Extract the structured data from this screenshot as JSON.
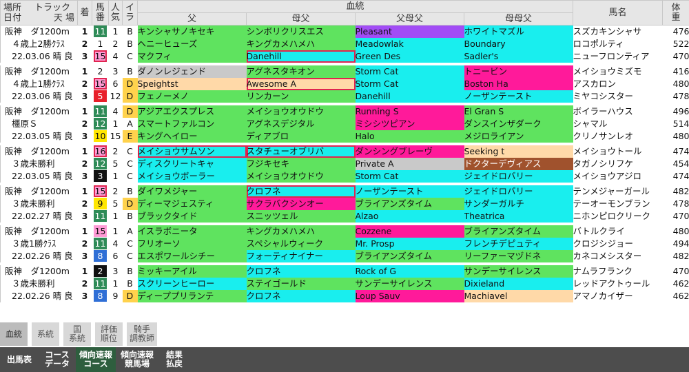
{
  "colors": {
    "green": "#5fe35f",
    "cyan": "#19eeee",
    "purple": "#a24df5",
    "pink": "#ff1a9a",
    "peach": "#ffd9a8",
    "gray": "#c9c9c9",
    "brown": "#a0522d",
    "highlight": "#e0244f"
  },
  "header": {
    "place": "場所",
    "date": "日付",
    "track": "トラック",
    "weather_field": "天 場",
    "finish": "着",
    "umaban_top": "馬",
    "umaban_bottom": "番",
    "pop_top": "人",
    "pop_bottom": "気",
    "ira_top": "イ",
    "ira_bottom": "ラ",
    "pedigree": "血統",
    "sire": "父",
    "dam_sire": "母父",
    "sire_sire": "父母父",
    "dam_dam_sire": "母母父",
    "horse_name": "馬名",
    "weight_top": "体",
    "weight_bottom": "重"
  },
  "races": [
    {
      "line1": "阪神　ダ1200m",
      "line2": "４歳上2勝ｸﾗｽ",
      "line3": "22.03.06 晴 良",
      "rows": [
        {
          "finish": "1",
          "umaban": "11",
          "umaban_bg": "#2e8b57",
          "umaban_fg": "#ffffff",
          "umaban_hl": false,
          "pop": "1",
          "ira": "B",
          "ira_bg": "",
          "p1": "キンシャサノキセキ",
          "p1c": "green",
          "p1hl": false,
          "p2": "シンボリクリスエス",
          "p2c": "green",
          "p2hl": false,
          "p3": "Pleasant",
          "p3c": "purple",
          "p3hl": false,
          "p4": "ホワイトマズル",
          "p4c": "cyan",
          "p4hl": false,
          "name": "スズカキンシャサ",
          "weight": "476"
        },
        {
          "finish": "2",
          "umaban": "1",
          "umaban_bg": "#ffffff",
          "umaban_fg": "#111111",
          "umaban_hl": false,
          "pop": "2",
          "ira": "B",
          "ira_bg": "",
          "p1": "ヘニーヒューズ",
          "p1c": "green",
          "p1hl": false,
          "p2": "キングカメハメハ",
          "p2c": "green",
          "p2hl": false,
          "p3": "Meadowlak",
          "p3c": "cyan",
          "p3hl": false,
          "p4": "Boundary",
          "p4c": "cyan",
          "p4hl": false,
          "name": "ロコポルティ",
          "weight": "522"
        },
        {
          "finish": "3",
          "umaban": "15",
          "umaban_bg": "#ff9ad5",
          "umaban_fg": "#111111",
          "umaban_hl": true,
          "pop": "4",
          "ira": "C",
          "ira_bg": "",
          "p1": "マクフィ",
          "p1c": "green",
          "p1hl": false,
          "p2": "Danehill",
          "p2c": "cyan",
          "p2hl": true,
          "p3": "Green Des",
          "p3c": "cyan",
          "p3hl": false,
          "p4": "Sadler's",
          "p4c": "cyan",
          "p4hl": false,
          "name": "ニューフロンティア",
          "weight": "470"
        }
      ]
    },
    {
      "line1": "阪神　ダ1200m",
      "line2": "４歳上1勝ｸﾗｽ",
      "line3": "22.03.06 晴 良",
      "rows": [
        {
          "finish": "1",
          "umaban": "2",
          "umaban_bg": "#ffffff",
          "umaban_fg": "#111111",
          "umaban_hl": false,
          "pop": "3",
          "ira": "B",
          "ira_bg": "",
          "p1": "ダノンレジェンド",
          "p1c": "gray",
          "p1hl": false,
          "p2": "アグネスタキオン",
          "p2c": "green",
          "p2hl": false,
          "p3": "Storm Cat",
          "p3c": "cyan",
          "p3hl": false,
          "p4": "トニービン",
          "p4c": "pink",
          "p4hl": false,
          "name": "メイショウミズモ",
          "weight": "416"
        },
        {
          "finish": "2",
          "umaban": "15",
          "umaban_bg": "#ff9ad5",
          "umaban_fg": "#111111",
          "umaban_hl": true,
          "pop": "6",
          "ira": "D",
          "ira_bg": "#ffd24d",
          "p1": "Speightst",
          "p1c": "peach",
          "p1hl": false,
          "p2": "Awesome A",
          "p2c": "peach",
          "p2hl": true,
          "p3": "Storm Cat",
          "p3c": "cyan",
          "p3hl": false,
          "p4": "Boston Ha",
          "p4c": "pink",
          "p4hl": false,
          "name": "アスカロン",
          "weight": "480"
        },
        {
          "finish": "3",
          "umaban": "5",
          "umaban_bg": "#e8202a",
          "umaban_fg": "#ffffff",
          "umaban_hl": false,
          "pop": "12",
          "ira": "D",
          "ira_bg": "#ffd24d",
          "p1": "フェノーメノ",
          "p1c": "green",
          "p1hl": false,
          "p2": "リンカーン",
          "p2c": "green",
          "p2hl": false,
          "p3": "Danehill",
          "p3c": "cyan",
          "p3hl": false,
          "p4": "ノーザンテースト",
          "p4c": "cyan",
          "p4hl": false,
          "name": "ミヤコシスター",
          "weight": "478"
        }
      ]
    },
    {
      "line1": "阪神　ダ1200m",
      "line2": "橿原Ｓ",
      "line3": "22.03.05 晴 良",
      "rows": [
        {
          "finish": "1",
          "umaban": "11",
          "umaban_bg": "#2e8b57",
          "umaban_fg": "#ffffff",
          "umaban_hl": false,
          "pop": "4",
          "ira": "D",
          "ira_bg": "#ffd24d",
          "p1": "アジアエクスプレス",
          "p1c": "green",
          "p1hl": false,
          "p2": "メイショウオウドウ",
          "p2c": "green",
          "p2hl": false,
          "p3": "Running S",
          "p3c": "pink",
          "p3hl": false,
          "p4": "El Gran S",
          "p4c": "green",
          "p4hl": false,
          "name": "ボイラーハウス",
          "weight": "496"
        },
        {
          "finish": "2",
          "umaban": "12",
          "umaban_bg": "#2e8b57",
          "umaban_fg": "#ffffff",
          "umaban_hl": false,
          "pop": "1",
          "ira": "A",
          "ira_bg": "",
          "p1": "スマートファルコン",
          "p1c": "green",
          "p1hl": false,
          "p2": "アグネスデジタル",
          "p2c": "green",
          "p2hl": false,
          "p3": "ミシシツピアン",
          "p3c": "pink",
          "p3hl": false,
          "p4": "ダンスインザダーク",
          "p4c": "green",
          "p4hl": false,
          "name": "シャマル",
          "weight": "514"
        },
        {
          "finish": "3",
          "umaban": "10",
          "umaban_bg": "#ffe600",
          "umaban_fg": "#111111",
          "umaban_hl": false,
          "pop": "15",
          "ira": "E",
          "ira_bg": "#ffd24d",
          "p1": "キングヘイロー",
          "p1c": "green",
          "p1hl": false,
          "p2": "ディアブロ",
          "p2c": "green",
          "p2hl": false,
          "p3": "Halo",
          "p3c": "green",
          "p3hl": false,
          "p4": "メジロライアン",
          "p4c": "green",
          "p4hl": false,
          "name": "クリノサンレオ",
          "weight": "480"
        }
      ]
    },
    {
      "line1": "阪神　ダ1200m",
      "line2": "３歳未勝利",
      "line3": "22.03.05 晴 良",
      "rows": [
        {
          "finish": "1",
          "umaban": "16",
          "umaban_bg": "#ff9ad5",
          "umaban_fg": "#111111",
          "umaban_hl": true,
          "pop": "2",
          "ira": "C",
          "ira_bg": "",
          "p1": "メイショウサムソン",
          "p1c": "cyan",
          "p1hl": true,
          "p2": "スタチューオブリバ",
          "p2c": "cyan",
          "p2hl": true,
          "p3": "ダンシングブレーヴ",
          "p3c": "pink",
          "p3hl": false,
          "p4": "Seeking t",
          "p4c": "peach",
          "p4hl": false,
          "name": "メイショウトール",
          "weight": "474"
        },
        {
          "finish": "2",
          "umaban": "12",
          "umaban_bg": "#2e8b57",
          "umaban_fg": "#ffffff",
          "umaban_hl": false,
          "pop": "5",
          "ira": "C",
          "ira_bg": "",
          "p1": "ディスクリートキャ",
          "p1c": "cyan",
          "p1hl": false,
          "p2": "フジキセキ",
          "p2c": "green",
          "p2hl": false,
          "p3": "Private A",
          "p3c": "gray",
          "p3hl": false,
          "p4": "ドクターデヴィアス",
          "p4c": "brown",
          "p4hl": false,
          "name": "タガノシリフケ",
          "weight": "454"
        },
        {
          "finish": "3",
          "umaban": "3",
          "umaban_bg": "#111111",
          "umaban_fg": "#ffffff",
          "umaban_hl": false,
          "pop": "1",
          "ira": "C",
          "ira_bg": "",
          "p1": "メイショウボーラー",
          "p1c": "cyan",
          "p1hl": false,
          "p2": "メイショウオウドウ",
          "p2c": "green",
          "p2hl": false,
          "p3": "Storm Cat",
          "p3c": "cyan",
          "p3hl": false,
          "p4": "ジェイドロバリー",
          "p4c": "cyan",
          "p4hl": false,
          "name": "メイショウアジロ",
          "weight": "474"
        }
      ]
    },
    {
      "line1": "阪神　ダ1200m",
      "line2": "３歳未勝利",
      "line3": "22.02.27 晴 良",
      "rows": [
        {
          "finish": "1",
          "umaban": "15",
          "umaban_bg": "#ff9ad5",
          "umaban_fg": "#111111",
          "umaban_hl": true,
          "pop": "2",
          "ira": "B",
          "ira_bg": "",
          "p1": "ダイワメジャー",
          "p1c": "green",
          "p1hl": false,
          "p2": "クロフネ",
          "p2c": "cyan",
          "p2hl": true,
          "p3": "ノーザンテースト",
          "p3c": "cyan",
          "p3hl": false,
          "p4": "ジェイドロバリー",
          "p4c": "cyan",
          "p4hl": false,
          "name": "テンメジャーガール",
          "weight": "482"
        },
        {
          "finish": "2",
          "umaban": "9",
          "umaban_bg": "#ffe600",
          "umaban_fg": "#111111",
          "umaban_hl": false,
          "pop": "5",
          "ira": "D",
          "ira_bg": "#ffd24d",
          "p1": "ディーマジェスティ",
          "p1c": "green",
          "p1hl": false,
          "p2": "サクラバクシンオー",
          "p2c": "pink",
          "p2hl": false,
          "p3": "ブライアンズタイム",
          "p3c": "green",
          "p3hl": false,
          "p4": "サンダーガルチ",
          "p4c": "cyan",
          "p4hl": false,
          "name": "テーオーモンブラン",
          "weight": "478"
        },
        {
          "finish": "3",
          "umaban": "11",
          "umaban_bg": "#2e8b57",
          "umaban_fg": "#ffffff",
          "umaban_hl": false,
          "pop": "1",
          "ira": "B",
          "ira_bg": "",
          "p1": "ブラックタイド",
          "p1c": "green",
          "p1hl": false,
          "p2": "スニッツェル",
          "p2c": "green",
          "p2hl": false,
          "p3": "Alzao",
          "p3c": "cyan",
          "p3hl": false,
          "p4": "Theatrica",
          "p4c": "cyan",
          "p4hl": false,
          "name": "ニホンピロクリーク",
          "weight": "470"
        }
      ]
    },
    {
      "line1": "阪神　ダ1200m",
      "line2": "３歳1勝ｸﾗｽ",
      "line3": "22.02.26 晴 良",
      "rows": [
        {
          "finish": "1",
          "umaban": "15",
          "umaban_bg": "#ff9ad5",
          "umaban_fg": "#111111",
          "umaban_hl": false,
          "pop": "1",
          "ira": "A",
          "ira_bg": "",
          "p1": "イスラボニータ",
          "p1c": "green",
          "p1hl": false,
          "p2": "キングカメハメハ",
          "p2c": "green",
          "p2hl": false,
          "p3": "Cozzene",
          "p3c": "pink",
          "p3hl": false,
          "p4": "ブライアンズタイム",
          "p4c": "green",
          "p4hl": false,
          "name": "バトルクライ",
          "weight": "480"
        },
        {
          "finish": "2",
          "umaban": "11",
          "umaban_bg": "#2e8b57",
          "umaban_fg": "#ffffff",
          "umaban_hl": false,
          "pop": "4",
          "ira": "C",
          "ira_bg": "",
          "p1": "フリオーソ",
          "p1c": "green",
          "p1hl": false,
          "p2": "スペシャルウィーク",
          "p2c": "green",
          "p2hl": false,
          "p3": "Mr. Prosp",
          "p3c": "cyan",
          "p3hl": false,
          "p4": "フレンチデピュティ",
          "p4c": "cyan",
          "p4hl": false,
          "name": "クロジシジョー",
          "weight": "494"
        },
        {
          "finish": "3",
          "umaban": "8",
          "umaban_bg": "#2f6fd6",
          "umaban_fg": "#ffffff",
          "umaban_hl": false,
          "pop": "6",
          "ira": "C",
          "ira_bg": "",
          "p1": "エスポワールシチー",
          "p1c": "green",
          "p1hl": false,
          "p2": "フォーティナイナー",
          "p2c": "cyan",
          "p2hl": false,
          "p3": "ブライアンズタイム",
          "p3c": "green",
          "p3hl": false,
          "p4": "リーファーマヅドネ",
          "p4c": "green",
          "p4hl": false,
          "name": "カネコメシスター",
          "weight": "482"
        }
      ]
    },
    {
      "line1": "阪神　ダ1200m",
      "line2": "３歳未勝利",
      "line3": "22.02.26 晴 良",
      "rows": [
        {
          "finish": "1",
          "umaban": "2",
          "umaban_bg": "#111111",
          "umaban_fg": "#ffffff",
          "umaban_hl": false,
          "pop": "3",
          "ira": "B",
          "ira_bg": "",
          "p1": "ミッキーアイル",
          "p1c": "green",
          "p1hl": false,
          "p2": "クロフネ",
          "p2c": "cyan",
          "p2hl": false,
          "p3": "Rock of G",
          "p3c": "cyan",
          "p3hl": false,
          "p4": "サンデーサイレンス",
          "p4c": "green",
          "p4hl": false,
          "name": "ナムラフランク",
          "weight": "470"
        },
        {
          "finish": "2",
          "umaban": "11",
          "umaban_bg": "#2e8b57",
          "umaban_fg": "#ffffff",
          "umaban_hl": false,
          "pop": "1",
          "ira": "B",
          "ira_bg": "",
          "p1": "スクリーンヒーロー",
          "p1c": "cyan",
          "p1hl": false,
          "p2": "ステイゴールド",
          "p2c": "green",
          "p2hl": false,
          "p3": "サンデーサイレンス",
          "p3c": "green",
          "p3hl": false,
          "p4": "Dixieland",
          "p4c": "cyan",
          "p4hl": false,
          "name": "レッドアクトゥール",
          "weight": "462"
        },
        {
          "finish": "3",
          "umaban": "8",
          "umaban_bg": "#2f6fd6",
          "umaban_fg": "#ffffff",
          "umaban_hl": false,
          "pop": "9",
          "ira": "D",
          "ira_bg": "#ffd24d",
          "p1": "ディーププリランテ",
          "p1c": "green",
          "p1hl": false,
          "p2": "クロフネ",
          "p2c": "cyan",
          "p2hl": false,
          "p3": "Loup Sauv",
          "p3c": "pink",
          "p3hl": false,
          "p4": "Machiavel",
          "p4c": "peach",
          "p4hl": false,
          "name": "アマノカイザー",
          "weight": "462"
        }
      ]
    }
  ],
  "tabs_top": [
    {
      "label": "血統",
      "active": true
    },
    {
      "label": "系統",
      "active": false
    },
    {
      "label": "国\n系統",
      "active": false
    },
    {
      "label": "評価\n順位",
      "active": false
    },
    {
      "label": "騎手\n調教師",
      "active": false
    }
  ],
  "tabs_bottom": [
    {
      "label": "出馬表",
      "active": false
    },
    {
      "label": "コース\nデータ",
      "active": false
    },
    {
      "label": "傾向速報\nコース",
      "active": true
    },
    {
      "label": "傾向速報\n競馬場",
      "active": false
    },
    {
      "label": "結果\n払戻",
      "active": false
    }
  ]
}
